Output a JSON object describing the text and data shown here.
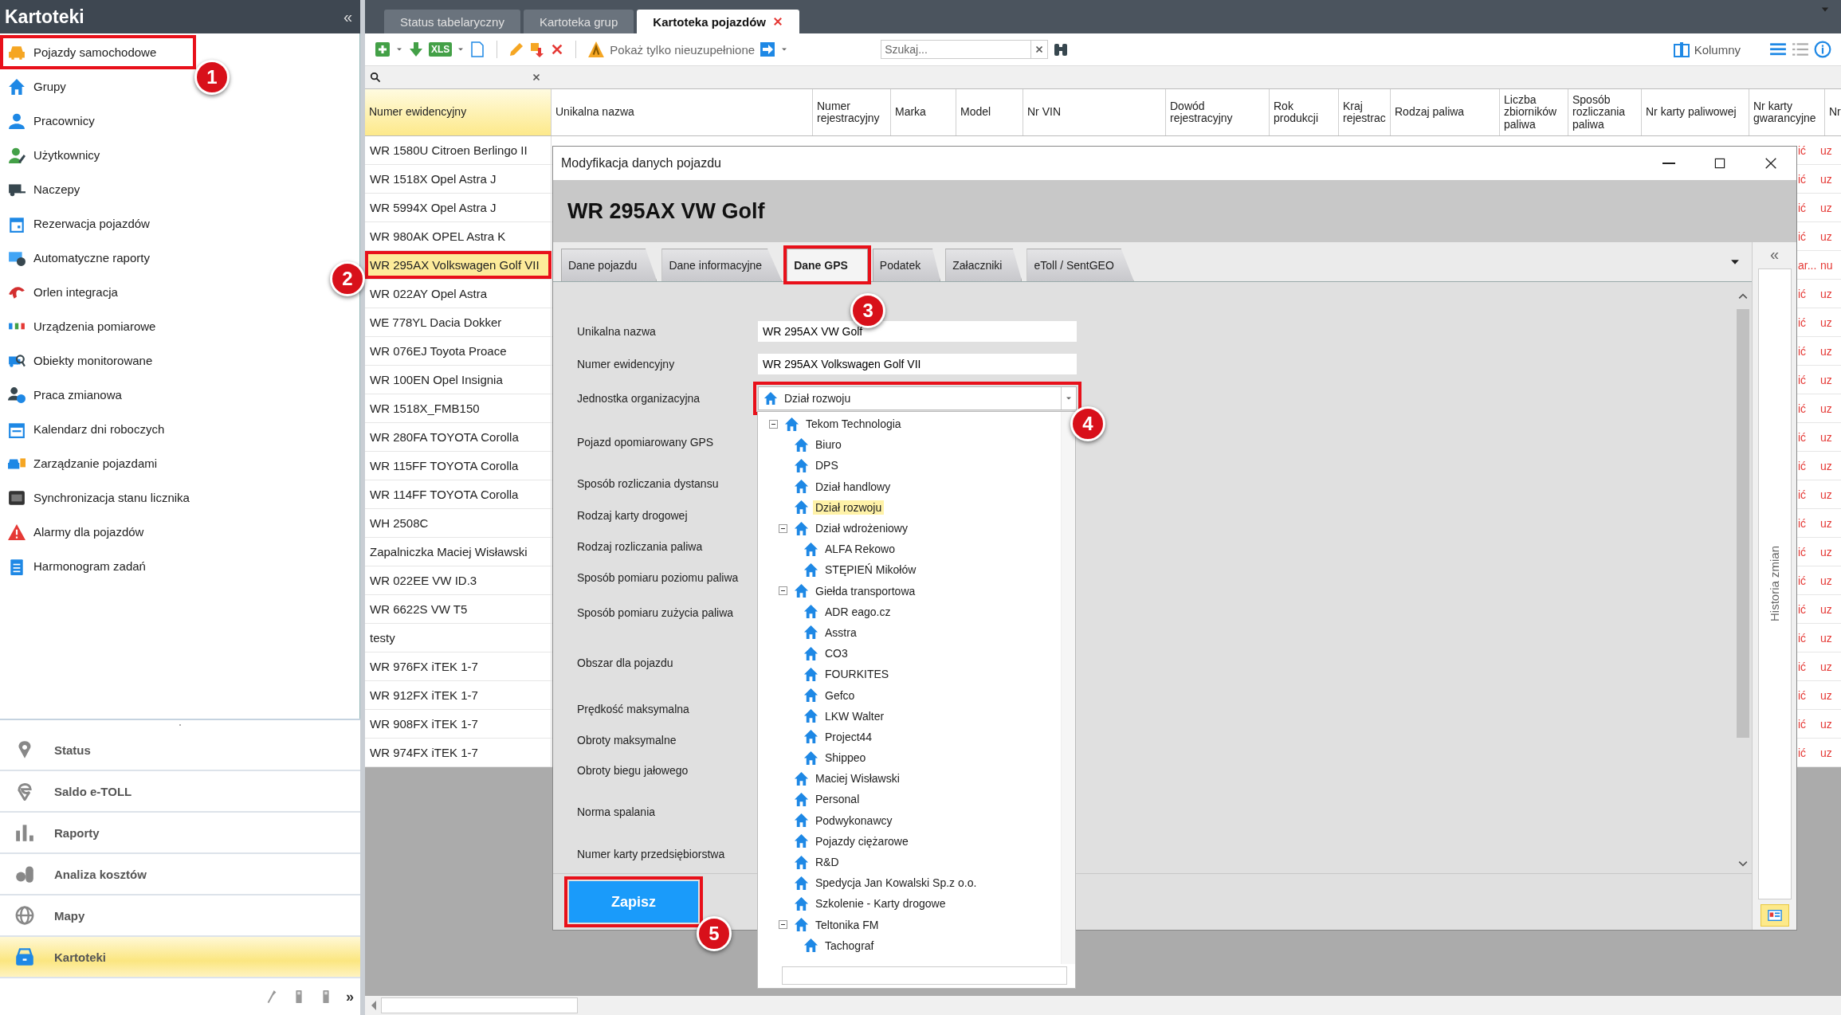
{
  "sidebar": {
    "title": "Kartoteki",
    "collapse_glyph": "«",
    "items": [
      {
        "label": "Pojazdy samochodowe",
        "callout": "1"
      },
      {
        "label": "Grupy"
      },
      {
        "label": "Pracownicy"
      },
      {
        "label": "Użytkownicy"
      },
      {
        "label": "Naczepy"
      },
      {
        "label": "Rezerwacja pojazdów"
      },
      {
        "label": "Automatyczne raporty"
      },
      {
        "label": "Orlen integracja"
      },
      {
        "label": "Urządzenia pomiarowe"
      },
      {
        "label": "Obiekty monitorowane"
      },
      {
        "label": "Praca zmianowa"
      },
      {
        "label": "Kalendarz dni roboczych"
      },
      {
        "label": "Zarządzanie pojazdami"
      },
      {
        "label": "Synchronizacja stanu licznika"
      },
      {
        "label": "Alarmy dla pojazdów"
      },
      {
        "label": "Harmonogram zadań"
      }
    ],
    "nav": [
      {
        "label": "Status",
        "selected": false
      },
      {
        "label": "Saldo e-TOLL",
        "selected": false
      },
      {
        "label": "Raporty",
        "selected": false
      },
      {
        "label": "Analiza kosztów",
        "selected": false
      },
      {
        "label": "Mapy",
        "selected": false
      },
      {
        "label": "Kartoteki",
        "selected": true
      }
    ],
    "overflow_glyph": "»"
  },
  "tabs": [
    {
      "label": "Status tabelaryczny",
      "selected": false,
      "closable": false
    },
    {
      "label": "Kartoteka grup",
      "selected": false,
      "closable": false
    },
    {
      "label": "Kartoteka pojazdów",
      "selected": true,
      "closable": true
    }
  ],
  "toolbar": {
    "xls": "XLS",
    "filter_label": "Pokaż tylko nieuzupełnione",
    "search_placeholder": "Szukaj...",
    "columns": "Kolumny"
  },
  "table": {
    "columns": [
      {
        "label": "Numer ewidencyjny",
        "selected": true
      },
      {
        "label": "Unikalna nazwa",
        "selected": false
      },
      {
        "label": "Numer rejestracyjny",
        "selected": false
      },
      {
        "label": "Marka",
        "selected": false
      },
      {
        "label": "Model",
        "selected": false
      },
      {
        "label": "Nr VIN",
        "selected": false
      },
      {
        "label": "Dowód rejestracyjny",
        "selected": false
      },
      {
        "label": "Rok produkcji",
        "selected": false
      },
      {
        "label": "Kraj rejestrac",
        "selected": false
      },
      {
        "label": "Rodzaj paliwa",
        "selected": false
      },
      {
        "label": "Liczba zbiorników paliwa",
        "selected": false
      },
      {
        "label": "Sposób rozliczania paliwa",
        "selected": false
      },
      {
        "label": "Nr karty paliwowej",
        "selected": false
      },
      {
        "label": "Nr karty gwarancyjne",
        "selected": false
      },
      {
        "label": "Nr",
        "selected": false
      }
    ],
    "rows": [
      {
        "numer": "WR 1580U Citroen Berlingo II",
        "col_a": "ić",
        "col_b": "uz",
        "selected": false
      },
      {
        "numer": "WR 1518X Opel Astra J",
        "col_a": "ić",
        "col_b": "uz",
        "selected": false
      },
      {
        "numer": "WR 5994X Opel Astra J",
        "col_a": "ić",
        "col_b": "uz",
        "selected": false
      },
      {
        "numer": "WR 980AK OPEL Astra K",
        "col_a": "ić",
        "col_b": "uz",
        "selected": false
      },
      {
        "numer": "WR 295AX Volkswagen Golf VII",
        "col_a": "ar...",
        "col_b": "nu",
        "selected": true,
        "callout": "2"
      },
      {
        "numer": "WR 022AY Opel Astra",
        "col_a": "ić",
        "col_b": "uz",
        "selected": false
      },
      {
        "numer": "WE 778YL Dacia Dokker",
        "col_a": "ić",
        "col_b": "uz",
        "selected": false
      },
      {
        "numer": "WR 076EJ Toyota Proace",
        "col_a": "ić",
        "col_b": "uz",
        "selected": false
      },
      {
        "numer": "WR 100EN Opel Insignia",
        "col_a": "ić",
        "col_b": "uz",
        "selected": false
      },
      {
        "numer": "WR 1518X_FMB150",
        "col_a": "ić",
        "col_b": "uz",
        "selected": false
      },
      {
        "numer": "WR 280FA TOYOTA Corolla",
        "col_a": "ić",
        "col_b": "uz",
        "selected": false
      },
      {
        "numer": "WR 115FF TOYOTA Corolla",
        "col_a": "ić",
        "col_b": "uz",
        "selected": false
      },
      {
        "numer": "WR 114FF TOYOTA Corolla",
        "col_a": "ić",
        "col_b": "uz",
        "selected": false
      },
      {
        "numer": "WH 2508C",
        "col_a": "ić",
        "col_b": "uz",
        "selected": false
      },
      {
        "numer": "Zapalniczka Maciej Wisławski",
        "col_a": "ić",
        "col_b": "uz",
        "selected": false
      },
      {
        "numer": "WR 022EE VW ID.3",
        "col_a": "ić",
        "col_b": "uz",
        "selected": false
      },
      {
        "numer": "WR 6622S VW T5",
        "col_a": "ić",
        "col_b": "uz",
        "selected": false
      },
      {
        "numer": "testy",
        "col_a": "ić",
        "col_b": "uz",
        "selected": false
      },
      {
        "numer": "WR 976FX iTEK 1-7",
        "col_a": "ić",
        "col_b": "uz",
        "selected": false
      },
      {
        "numer": "WR 912FX iTEK 1-7",
        "col_a": "ić",
        "col_b": "uz",
        "selected": false
      },
      {
        "numer": "WR 908FX iTEK 1-7",
        "col_a": "ić",
        "col_b": "uz",
        "selected": false
      },
      {
        "numer": "WR 974FX iTEK 1-7",
        "col_a": "ić",
        "col_b": "uz",
        "selected": false
      }
    ]
  },
  "dialog": {
    "title": "Modyfikacja danych pojazdu",
    "heading": "WR 295AX VW Golf",
    "tabs": [
      {
        "label": "Dane pojazdu",
        "selected": false
      },
      {
        "label": "Dane informacyjne",
        "selected": false
      },
      {
        "label": "Dane GPS",
        "selected": true,
        "callout": "3"
      },
      {
        "label": "Podatek",
        "selected": false
      },
      {
        "label": "Załaczniki",
        "selected": false
      },
      {
        "label": "eToll / SentGEO",
        "selected": false
      }
    ],
    "fields": [
      {
        "label": "Unikalna nazwa",
        "kind": "text",
        "value": "WR 295AX VW Golf"
      },
      {
        "label": "Numer ewidencyjny",
        "kind": "text",
        "value": "WR 295AX Volkswagen Golf VII"
      },
      {
        "label": "Jednostka organizacyjna",
        "kind": "select",
        "value": "Dział rozwoju",
        "callout": "4"
      },
      {
        "label": "Pojazd opomiarowany GPS",
        "kind": "label"
      },
      {
        "label": "Sposób rozliczania dystansu",
        "kind": "label"
      },
      {
        "label": "Rodzaj karty drogowej",
        "kind": "label"
      },
      {
        "label": "Rodzaj rozliczania paliwa",
        "kind": "label"
      },
      {
        "label": "Sposób pomiaru poziomu paliwa",
        "kind": "label"
      },
      {
        "label": "Sposób pomiaru zużycia paliwa",
        "kind": "label"
      },
      {
        "label": "Obszar dla pojazdu",
        "kind": "label"
      },
      {
        "label": "Prędkość maksymalna",
        "kind": "label"
      },
      {
        "label": "Obroty maksymalne",
        "kind": "label"
      },
      {
        "label": "Obroty biegu jałowego",
        "kind": "label"
      },
      {
        "label": "Norma spalania",
        "kind": "label"
      },
      {
        "label": "Numer karty przedsiębiorstwa",
        "kind": "label"
      }
    ],
    "save": {
      "label": "Zapisz",
      "callout": "5"
    },
    "side_panel": {
      "title": "Historia zmian",
      "collapse_glyph": "«"
    },
    "dropdown": {
      "tree": [
        {
          "label": "Tekom Technologia",
          "selected": false,
          "expanded": true,
          "children": [
            {
              "label": "Biuro",
              "selected": false
            },
            {
              "label": "DPS",
              "selected": false
            },
            {
              "label": "Dział handlowy",
              "selected": false
            },
            {
              "label": "Dział rozwoju",
              "selected": true
            },
            {
              "label": "Dział wdrożeniowy",
              "selected": false,
              "expanded": true,
              "children": [
                {
                  "label": "ALFA Rekowo",
                  "selected": false
                },
                {
                  "label": "STĘPIEŃ Mikołów",
                  "selected": false
                }
              ]
            },
            {
              "label": "Giełda transportowa",
              "selected": false,
              "expanded": true,
              "children": [
                {
                  "label": "ADR eago.cz",
                  "selected": false
                },
                {
                  "label": "Asstra",
                  "selected": false
                },
                {
                  "label": "CO3",
                  "selected": false
                },
                {
                  "label": "FOURKITES",
                  "selected": false
                },
                {
                  "label": "Gefco",
                  "selected": false
                },
                {
                  "label": "LKW Walter",
                  "selected": false
                },
                {
                  "label": "Project44",
                  "selected": false
                },
                {
                  "label": "Shippeo",
                  "selected": false
                }
              ]
            },
            {
              "label": "Maciej Wisławski",
              "selected": false
            },
            {
              "label": "Personal",
              "selected": false
            },
            {
              "label": "Podwykonawcy",
              "selected": false
            },
            {
              "label": "Pojazdy ciężarowe",
              "selected": false
            },
            {
              "label": "R&D",
              "selected": false
            },
            {
              "label": "Spedycja Jan Kowalski Sp.z o.o.",
              "selected": false
            },
            {
              "label": "Szkolenie - Karty drogowe",
              "selected": false
            },
            {
              "label": "Teltonika FM",
              "selected": false,
              "expanded": true,
              "children": [
                {
                  "label": "Tachograf",
                  "selected": false
                }
              ]
            }
          ]
        }
      ]
    }
  }
}
